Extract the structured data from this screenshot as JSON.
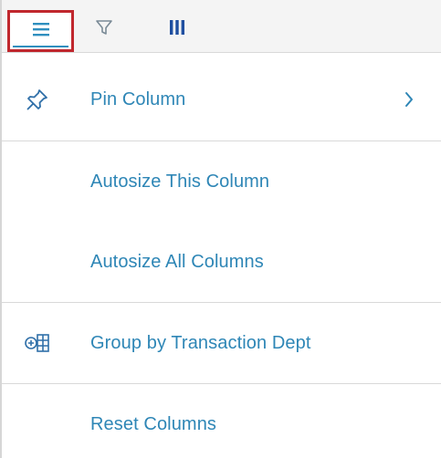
{
  "tabs": [
    {
      "name": "general",
      "icon": "menu-icon",
      "active": true
    },
    {
      "name": "filter",
      "icon": "filter-icon",
      "active": false
    },
    {
      "name": "columns",
      "icon": "columns-icon",
      "active": false
    }
  ],
  "menu": {
    "items": [
      {
        "label": "Pin Column",
        "icon": "pin-icon",
        "has_submenu": true
      },
      {
        "label": "Autosize This Column",
        "icon": null,
        "has_submenu": false
      },
      {
        "label": "Autosize All Columns",
        "icon": null,
        "has_submenu": false
      },
      {
        "label": "Group by Transaction Dept",
        "icon": "group-icon",
        "has_submenu": false
      },
      {
        "label": "Reset Columns",
        "icon": null,
        "has_submenu": false
      }
    ]
  },
  "colors": {
    "accent": "#2e86b6",
    "highlight_border": "#c0272d",
    "divider": "#d9d9d9",
    "tabbar_background": "#f4f4f4"
  }
}
